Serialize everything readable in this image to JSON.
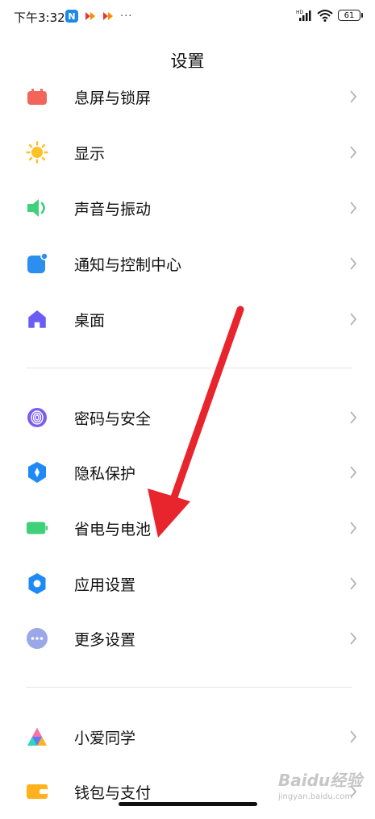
{
  "status_bar": {
    "time": "下午3:32",
    "app_badge": "N",
    "dots": "···",
    "signal_label": "HD",
    "battery": "61"
  },
  "page_title": "设置",
  "items": [
    {
      "label": "息屏与锁屏",
      "icon": "lock-screen-icon",
      "color": "#f2665a"
    },
    {
      "label": "显示",
      "icon": "sun-icon",
      "color": "#ffc226"
    },
    {
      "label": "声音与振动",
      "icon": "speaker-icon",
      "color": "#3fd07a"
    },
    {
      "label": "通知与控制中心",
      "icon": "notification-icon",
      "color": "#2b8ff0"
    },
    {
      "label": "桌面",
      "icon": "home-icon",
      "color": "#6a5cf5"
    },
    {
      "label": "密码与安全",
      "icon": "fingerprint-icon",
      "color": "#7c5cf0"
    },
    {
      "label": "隐私保护",
      "icon": "privacy-shield-icon",
      "color": "#1e8af5"
    },
    {
      "label": "省电与电池",
      "icon": "battery-icon",
      "color": "#3fd07a"
    },
    {
      "label": "应用设置",
      "icon": "gear-icon",
      "color": "#1e8af5"
    },
    {
      "label": "更多设置",
      "icon": "more-icon",
      "color": "#9aa8e8"
    },
    {
      "label": "小爱同学",
      "icon": "xiaoai-icon",
      "color": "#5b7cf7"
    },
    {
      "label": "钱包与支付",
      "icon": "wallet-icon",
      "color": "#ffb21e"
    }
  ],
  "watermark": {
    "main": "Baidu经验",
    "sub": "jingyan.baidu.com"
  }
}
